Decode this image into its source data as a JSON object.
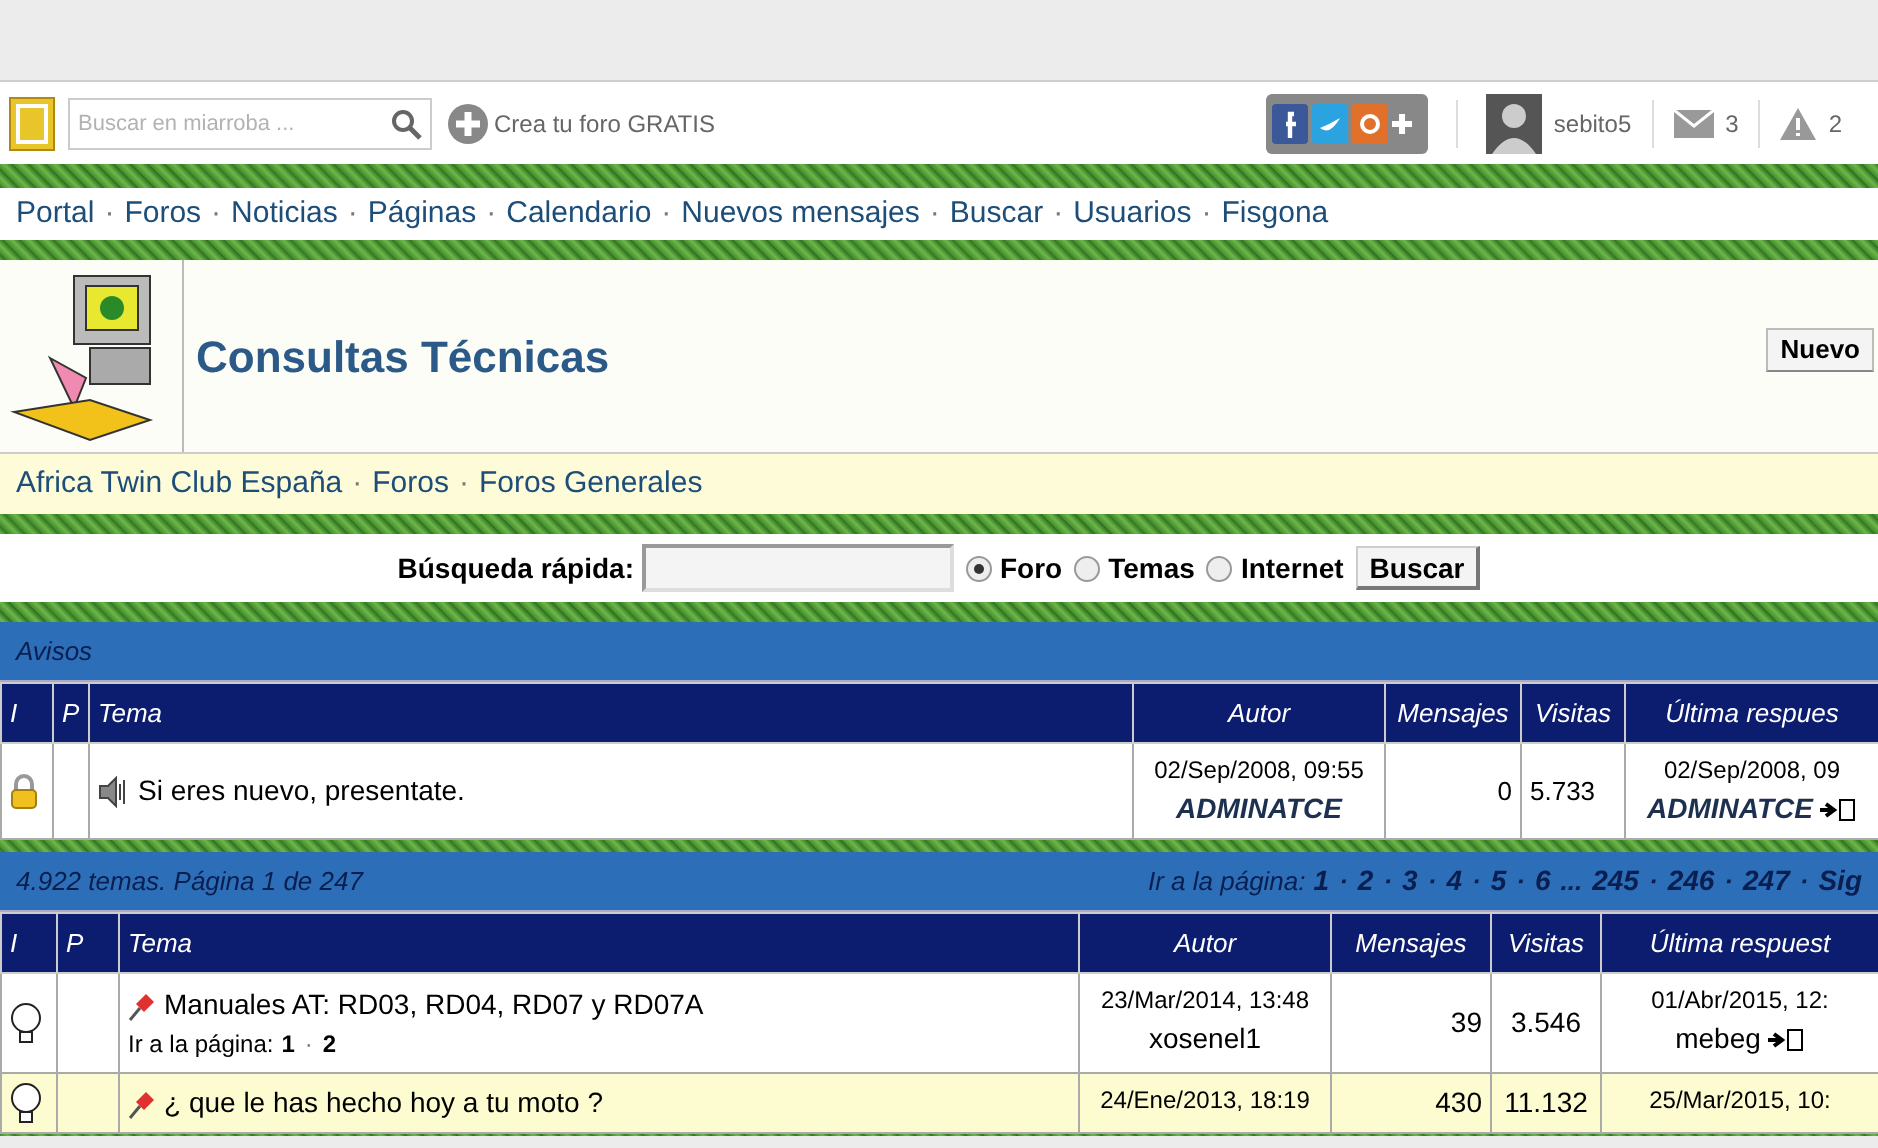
{
  "toolbar": {
    "search": {
      "placeholder": "Buscar en miarroba ..."
    },
    "create_link": "Crea tu foro GRATIS",
    "user": "sebito5",
    "messages": "3",
    "alerts": "2"
  },
  "nav": [
    {
      "kind": "link",
      "text": "Portal"
    },
    {
      "kind": "separator",
      "text": "·"
    },
    {
      "kind": "link",
      "text": "Foros"
    },
    {
      "kind": "separator",
      "text": "·"
    },
    {
      "kind": "link",
      "text": "Noticias"
    },
    {
      "kind": "separator",
      "text": "·"
    },
    {
      "kind": "link",
      "text": "Páginas"
    },
    {
      "kind": "separator",
      "text": "·"
    },
    {
      "kind": "link",
      "text": "Calendario"
    },
    {
      "kind": "separator",
      "text": "·"
    },
    {
      "kind": "link",
      "text": "Nuevos mensajes"
    },
    {
      "kind": "separator",
      "text": "·"
    },
    {
      "kind": "link",
      "text": "Buscar"
    },
    {
      "kind": "separator",
      "text": "·"
    },
    {
      "kind": "link",
      "text": "Usuarios"
    },
    {
      "kind": "separator",
      "text": "·"
    },
    {
      "kind": "link",
      "text": "Fisgona"
    }
  ],
  "header": {
    "title": "Consultas Técnicas",
    "button": "Nuevo"
  },
  "breadcrumb": [
    {
      "kind": "link",
      "text": "Africa Twin Club España"
    },
    {
      "kind": "separator",
      "text": "·"
    },
    {
      "kind": "link",
      "text": "Foros"
    },
    {
      "kind": "separator",
      "text": "·"
    },
    {
      "kind": "link",
      "text": "Foros Generales"
    }
  ],
  "quick_search": {
    "label": "Búsqueda rápida:",
    "options": [
      {
        "label": "Foro",
        "selected": true
      },
      {
        "label": "Temas",
        "selected": false
      },
      {
        "label": "Internet",
        "selected": false
      }
    ],
    "button": "Buscar"
  },
  "notices": {
    "title": "Avisos",
    "columns": [
      "I",
      "P",
      "Tema",
      "Autor",
      "Mensajes",
      "Visitas",
      "Última respues"
    ],
    "rows": [
      {
        "title": "Si eres nuevo, presentate.",
        "author_date": "02/Sep/2008, 09:55",
        "author": "ADMINATCE",
        "messages": "0",
        "visits": "5.733",
        "last_date": "02/Sep/2008, 09",
        "last_user": "ADMINATCE"
      }
    ]
  },
  "topics": {
    "summary": "4.922 temas. Página 1 de 247",
    "pages_label": "Ir a la página:",
    "pages": [
      {
        "kind": "link",
        "text": "1"
      },
      {
        "kind": "separator",
        "text": "·"
      },
      {
        "kind": "link",
        "text": "2"
      },
      {
        "kind": "separator",
        "text": "·"
      },
      {
        "kind": "link",
        "text": "3"
      },
      {
        "kind": "separator",
        "text": "·"
      },
      {
        "kind": "link",
        "text": "4"
      },
      {
        "kind": "separator",
        "text": "·"
      },
      {
        "kind": "link",
        "text": "5"
      },
      {
        "kind": "separator",
        "text": "·"
      },
      {
        "kind": "link",
        "text": "6"
      },
      {
        "kind": "separator",
        "text": "..."
      },
      {
        "kind": "link",
        "text": "245"
      },
      {
        "kind": "separator",
        "text": "·"
      },
      {
        "kind": "link",
        "text": "246"
      },
      {
        "kind": "separator",
        "text": "·"
      },
      {
        "kind": "link",
        "text": "247"
      },
      {
        "kind": "separator",
        "text": "·"
      },
      {
        "kind": "link",
        "text": "Sig"
      }
    ],
    "columns": [
      "I",
      "P",
      "Tema",
      "Autor",
      "Mensajes",
      "Visitas",
      "Última respuest"
    ],
    "rows": [
      {
        "title": "Manuales AT: RD03, RD04, RD07 y RD07A",
        "pages_label": "Ir a la página:",
        "pages": [
          {
            "kind": "link",
            "text": "1"
          },
          {
            "kind": "separator",
            "text": "·"
          },
          {
            "kind": "link",
            "text": "2"
          }
        ],
        "author_date": "23/Mar/2014, 13:48",
        "author": "xosenel1",
        "messages": "39",
        "visits": "3.546",
        "last_date": "01/Abr/2015, 12:",
        "last_user": "mebeg"
      },
      {
        "title": "¿ que le has hecho hoy a tu moto ?",
        "author_date": "24/Ene/2013, 18:19",
        "messages": "430",
        "visits": "11.132",
        "last_date": "25/Mar/2015, 10:"
      }
    ]
  }
}
